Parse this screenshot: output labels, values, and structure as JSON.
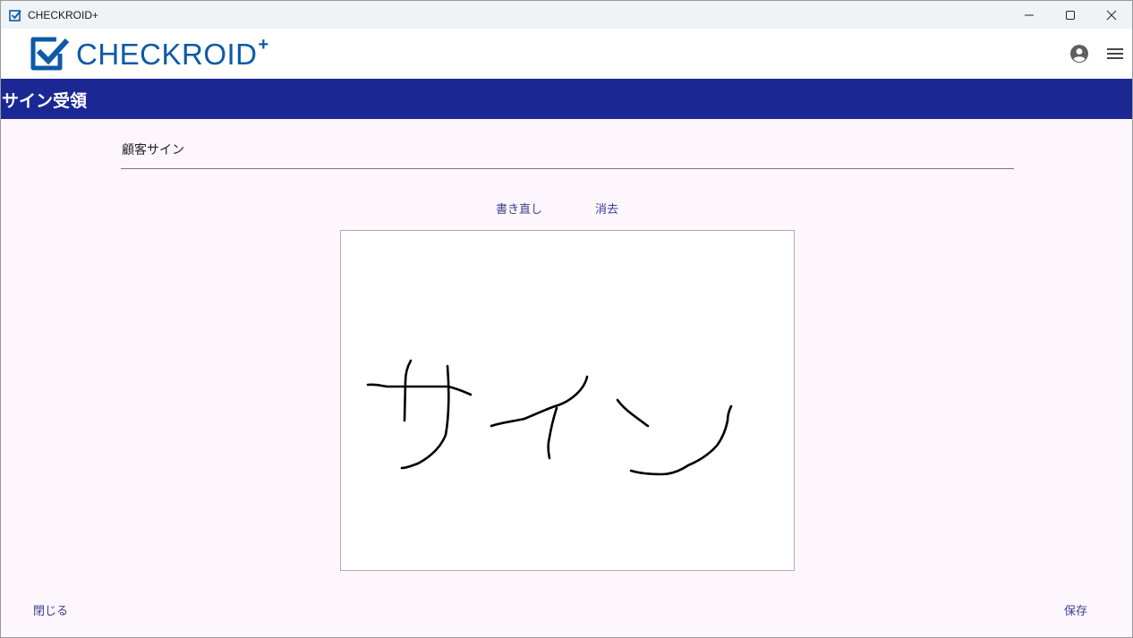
{
  "window": {
    "title": "CHECKROID+",
    "controls": {
      "minimize": "minimize-icon",
      "maximize": "maximize-icon",
      "close": "close-icon"
    }
  },
  "header": {
    "logo_text": "CHECKROID",
    "logo_plus": "+",
    "icons": {
      "account": "account-circle-icon",
      "menu": "hamburger-menu-icon"
    }
  },
  "page": {
    "title": "サイン受領"
  },
  "signature": {
    "label": "顧客サイン",
    "redraw_label": "書き直し",
    "clear_label": "消去"
  },
  "footer": {
    "close_label": "閉じる",
    "save_label": "保存"
  },
  "colors": {
    "title_bar": "#eef3f8",
    "brand": "#0d5aa6",
    "page_bar": "#1b2893",
    "background": "#fdf6fd",
    "button_text": "#3b3f8e"
  }
}
